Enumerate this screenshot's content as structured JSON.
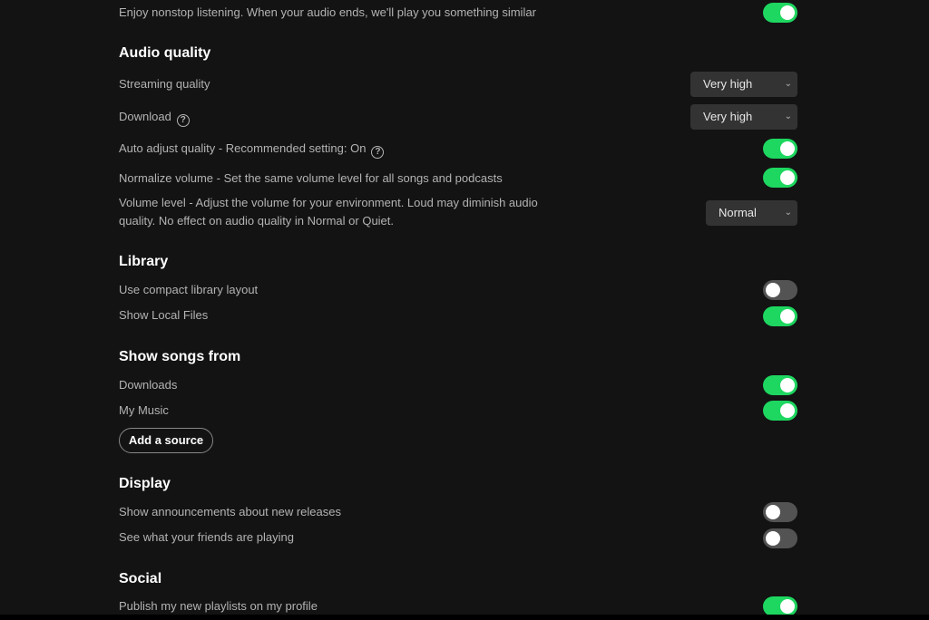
{
  "colors": {
    "background": "#131313",
    "accent_green": "#1ed760",
    "toggle_off": "#535353",
    "dropdown_bg": "#333333",
    "heading": "#ffffff",
    "label": "#b3b3b3"
  },
  "autoplay": {
    "label": "Enjoy nonstop listening. When your audio ends, we'll play you something similar",
    "enabled": true
  },
  "audio_quality": {
    "heading": "Audio quality",
    "streaming_quality": {
      "label": "Streaming quality",
      "value": "Very high"
    },
    "download": {
      "label": "Download",
      "value": "Very high",
      "help_icon": "question-circle-icon"
    },
    "auto_adjust": {
      "label": "Auto adjust quality - Recommended setting: On",
      "enabled": true,
      "help_icon": "question-circle-icon"
    },
    "normalize_volume": {
      "label": "Normalize volume - Set the same volume level for all songs and podcasts",
      "enabled": true
    },
    "volume_level": {
      "label": "Volume level - Adjust the volume for your environment. Loud may diminish audio quality. No effect on audio quality in Normal or Quiet.",
      "value": "Normal"
    }
  },
  "library": {
    "heading": "Library",
    "compact_layout": {
      "label": "Use compact library layout",
      "enabled": false
    },
    "show_local_files": {
      "label": "Show Local Files",
      "enabled": true
    }
  },
  "show_songs_from": {
    "heading": "Show songs from",
    "sources": [
      {
        "label": "Downloads",
        "enabled": true
      },
      {
        "label": "My Music",
        "enabled": true
      }
    ],
    "add_source_label": "Add a source"
  },
  "display": {
    "heading": "Display",
    "announcements": {
      "label": "Show announcements about new releases",
      "enabled": false
    },
    "friends_playing": {
      "label": "See what your friends are playing",
      "enabled": false
    }
  },
  "social": {
    "heading": "Social",
    "publish_playlists": {
      "label": "Publish my new playlists on my profile",
      "enabled": true
    }
  },
  "icons": {
    "chevron": "⌄",
    "help": "?"
  }
}
